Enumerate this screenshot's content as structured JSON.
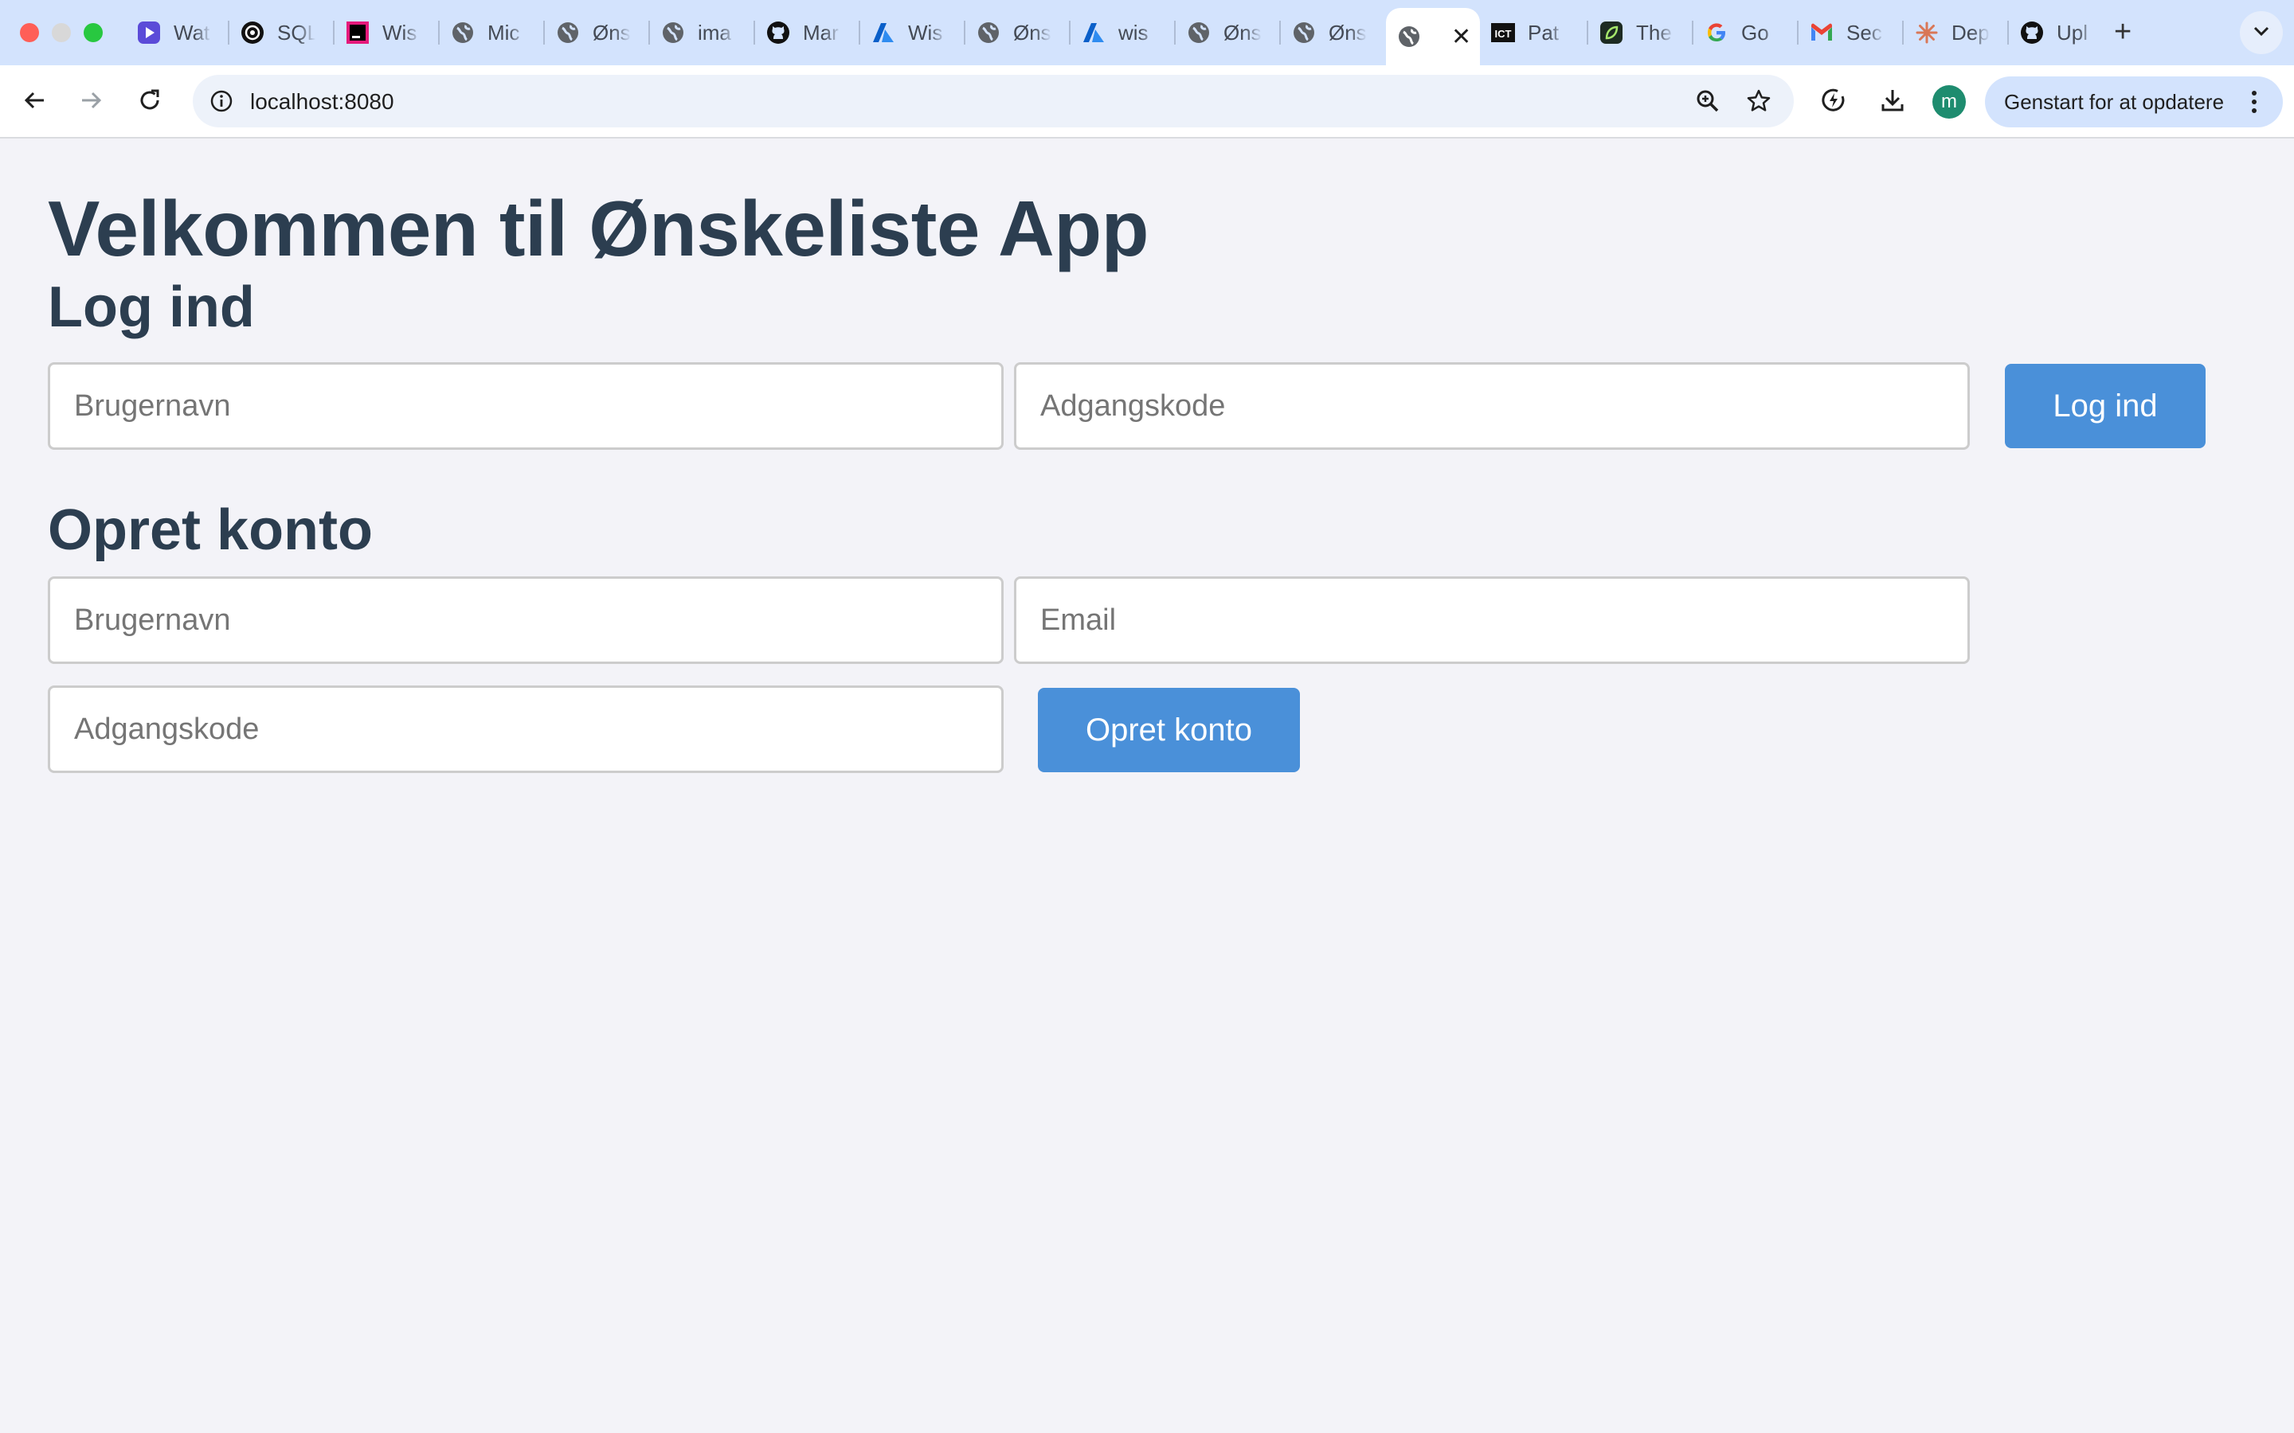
{
  "browser": {
    "tabs": [
      {
        "label": "Wat",
        "icon": "video-icon"
      },
      {
        "label": "SQL",
        "icon": "openai-icon"
      },
      {
        "label": "Wis",
        "icon": "jetbrains-icon"
      },
      {
        "label": "Mic",
        "icon": "globe-icon"
      },
      {
        "label": "Øns",
        "icon": "globe-icon"
      },
      {
        "label": "ima",
        "icon": "globe-icon"
      },
      {
        "label": "Mar",
        "icon": "github-icon"
      },
      {
        "label": "Wis",
        "icon": "azure-icon"
      },
      {
        "label": "Øns",
        "icon": "globe-icon"
      },
      {
        "label": "wis",
        "icon": "azure-icon"
      },
      {
        "label": "Øns",
        "icon": "globe-icon"
      },
      {
        "label": "Øns",
        "icon": "globe-icon"
      },
      {
        "label": "",
        "icon": "globe-icon",
        "active": true
      },
      {
        "label": "Pat",
        "icon": "news-icon"
      },
      {
        "label": "The",
        "icon": "leaf-icon"
      },
      {
        "label": "Go",
        "icon": "google-icon"
      },
      {
        "label": "Sec",
        "icon": "gmail-icon"
      },
      {
        "label": "Dep",
        "icon": "claude-icon"
      },
      {
        "label": "Upl",
        "icon": "github-icon"
      }
    ],
    "url": "localhost:8080",
    "restart_label": "Genstart for at opdatere",
    "avatar_letter": "m"
  },
  "page": {
    "title": "Velkommen til Ønskeliste App",
    "login": {
      "heading": "Log ind",
      "username_placeholder": "Brugernavn",
      "password_placeholder": "Adgangskode",
      "button_label": "Log ind"
    },
    "register": {
      "heading": "Opret konto",
      "username_placeholder": "Brugernavn",
      "email_placeholder": "Email",
      "password_placeholder": "Adgangskode",
      "button_label": "Opret konto"
    }
  },
  "colors": {
    "accent": "#4a90d9",
    "heading": "#2c3e50",
    "background": "#f3f3f8"
  }
}
